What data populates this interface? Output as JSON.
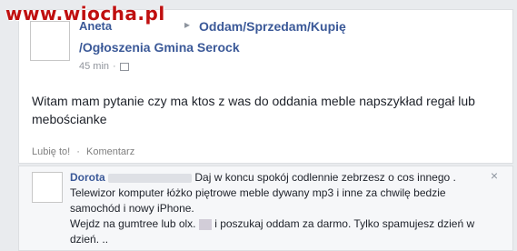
{
  "watermark": "www.wiocha.pl",
  "post": {
    "author": "Aneta",
    "arrow": "▸",
    "group_line1": "Oddam/Sprzedam/Kupię",
    "group_line2": "/Ogłoszenia Gmina Serock",
    "time": "45 min",
    "dot": "·",
    "text": "Witam mam pytanie czy ma ktos z was do oddania meble napszykład regał lub mebościanke",
    "like": "Lubię to!",
    "sep": "·",
    "comment": "Komentarz"
  },
  "comment": {
    "author": "Dorota",
    "text_part1": "Daj w koncu spokój codlennie zebrzesz o cos innego . Telewizor komputer łóżko piętrowe meble dywany mp3 i inne za chwilę bedzie samochód i nowy iPhone.",
    "text_part2": "Wejdz na gumtree lub olx.",
    "text_part3": "i poszukaj oddam za darmo. Tylko spamujesz dzień w dzień. ..",
    "close": "×"
  },
  "colors": {
    "link": "#3b5998",
    "watermark": "#c01010"
  },
  "icons": {
    "audience": "group-audience-icon",
    "close": "close-icon"
  }
}
